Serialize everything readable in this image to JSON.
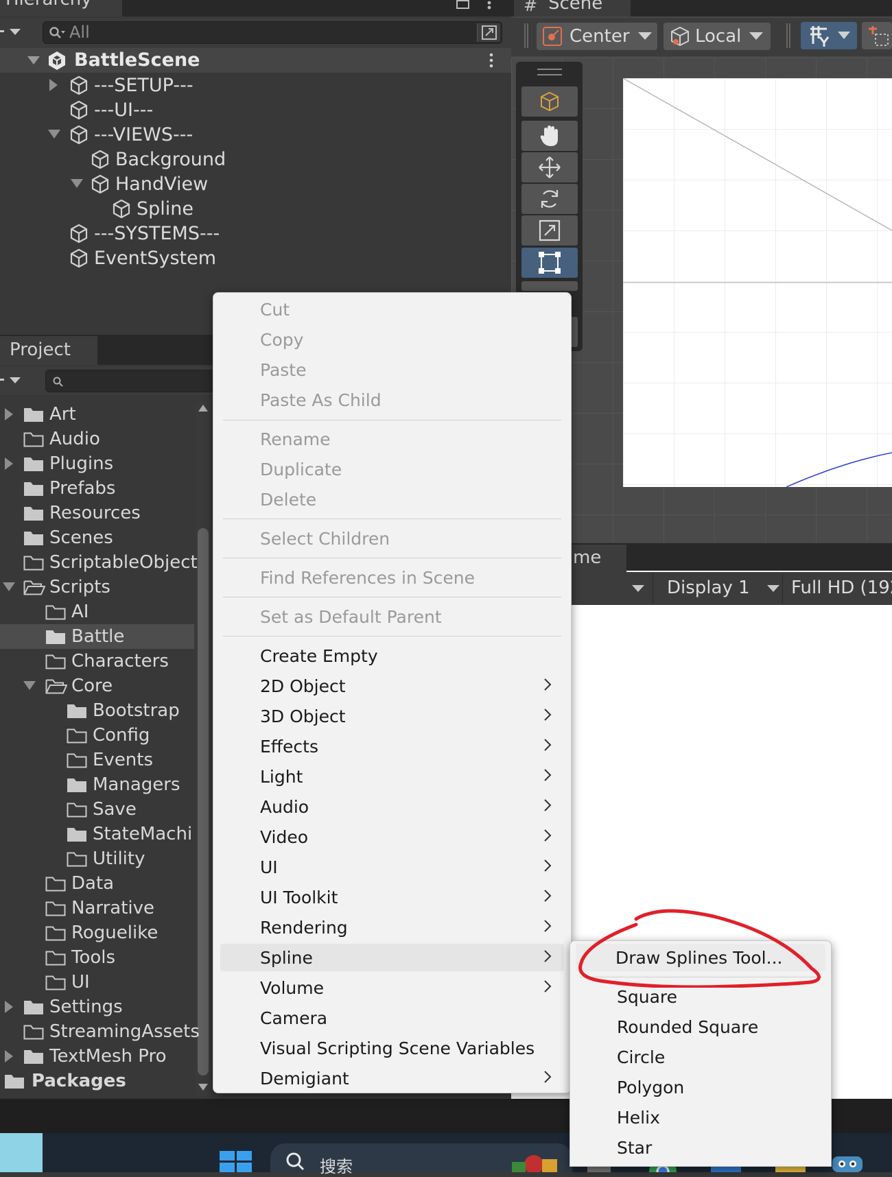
{
  "hierarchy": {
    "tab_label": "Hierarchy",
    "search_placeholder": "All",
    "scene_name": "BattleScene",
    "items": [
      {
        "label": "---SETUP---"
      },
      {
        "label": "---UI---"
      },
      {
        "label": "---VIEWS---"
      },
      {
        "label": "Background"
      },
      {
        "label": "HandView"
      },
      {
        "label": "Spline"
      },
      {
        "label": "---SYSTEMS---"
      },
      {
        "label": "EventSystem"
      }
    ]
  },
  "scene_view": {
    "tab_label": "Scene",
    "pivot_label": "Center",
    "space_label": "Local"
  },
  "game_view": {
    "tab_label": "me",
    "display_label": "Display 1",
    "resolution_label": "Full HD (192"
  },
  "project": {
    "tab_label": "Project",
    "folders": [
      {
        "label": "Art"
      },
      {
        "label": "Audio"
      },
      {
        "label": "Plugins"
      },
      {
        "label": "Prefabs"
      },
      {
        "label": "Resources"
      },
      {
        "label": "Scenes"
      },
      {
        "label": "ScriptableObject"
      },
      {
        "label": "Scripts"
      },
      {
        "label": "AI"
      },
      {
        "label": "Battle"
      },
      {
        "label": "Characters"
      },
      {
        "label": "Core"
      },
      {
        "label": "Bootstrap"
      },
      {
        "label": "Config"
      },
      {
        "label": "Events"
      },
      {
        "label": "Managers"
      },
      {
        "label": "Save"
      },
      {
        "label": "StateMachi"
      },
      {
        "label": "Utility"
      },
      {
        "label": "Data"
      },
      {
        "label": "Narrative"
      },
      {
        "label": "Roguelike"
      },
      {
        "label": "Tools"
      },
      {
        "label": "UI"
      },
      {
        "label": "Settings"
      },
      {
        "label": "StreamingAssets"
      },
      {
        "label": "TextMesh Pro"
      },
      {
        "label": "Packages"
      }
    ]
  },
  "context_menu": {
    "items": [
      {
        "label": "Cut",
        "enabled": false,
        "submenu": false
      },
      {
        "label": "Copy",
        "enabled": false,
        "submenu": false
      },
      {
        "label": "Paste",
        "enabled": false,
        "submenu": false
      },
      {
        "label": "Paste As Child",
        "enabled": false,
        "submenu": false
      },
      {
        "label": "Rename",
        "enabled": false,
        "submenu": false
      },
      {
        "label": "Duplicate",
        "enabled": false,
        "submenu": false
      },
      {
        "label": "Delete",
        "enabled": false,
        "submenu": false
      },
      {
        "label": "Select Children",
        "enabled": false,
        "submenu": false
      },
      {
        "label": "Find References in Scene",
        "enabled": false,
        "submenu": false
      },
      {
        "label": "Set as Default Parent",
        "enabled": false,
        "submenu": false
      },
      {
        "label": "Create Empty",
        "enabled": true,
        "submenu": false
      },
      {
        "label": "2D Object",
        "enabled": true,
        "submenu": true
      },
      {
        "label": "3D Object",
        "enabled": true,
        "submenu": true
      },
      {
        "label": "Effects",
        "enabled": true,
        "submenu": true
      },
      {
        "label": "Light",
        "enabled": true,
        "submenu": true
      },
      {
        "label": "Audio",
        "enabled": true,
        "submenu": true
      },
      {
        "label": "Video",
        "enabled": true,
        "submenu": true
      },
      {
        "label": "UI",
        "enabled": true,
        "submenu": true
      },
      {
        "label": "UI Toolkit",
        "enabled": true,
        "submenu": true
      },
      {
        "label": "Rendering",
        "enabled": true,
        "submenu": true
      },
      {
        "label": "Spline",
        "enabled": true,
        "submenu": true,
        "highlighted": true
      },
      {
        "label": "Volume",
        "enabled": true,
        "submenu": true
      },
      {
        "label": "Camera",
        "enabled": true,
        "submenu": false
      },
      {
        "label": "Visual Scripting Scene Variables",
        "enabled": true,
        "submenu": false
      },
      {
        "label": "Demigiant",
        "enabled": true,
        "submenu": true
      }
    ]
  },
  "spline_submenu": {
    "items": [
      {
        "label": "Draw Splines Tool...",
        "annotated": true
      },
      {
        "label": "Square"
      },
      {
        "label": "Rounded Square"
      },
      {
        "label": "Circle"
      },
      {
        "label": "Polygon"
      },
      {
        "label": "Helix"
      },
      {
        "label": "Star"
      }
    ]
  },
  "taskbar": {
    "search_label": "搜索"
  },
  "colors": {
    "annotation": "#e0202a",
    "selected_tool": "#4a6e96",
    "menu_background": "#f2f2f2"
  }
}
